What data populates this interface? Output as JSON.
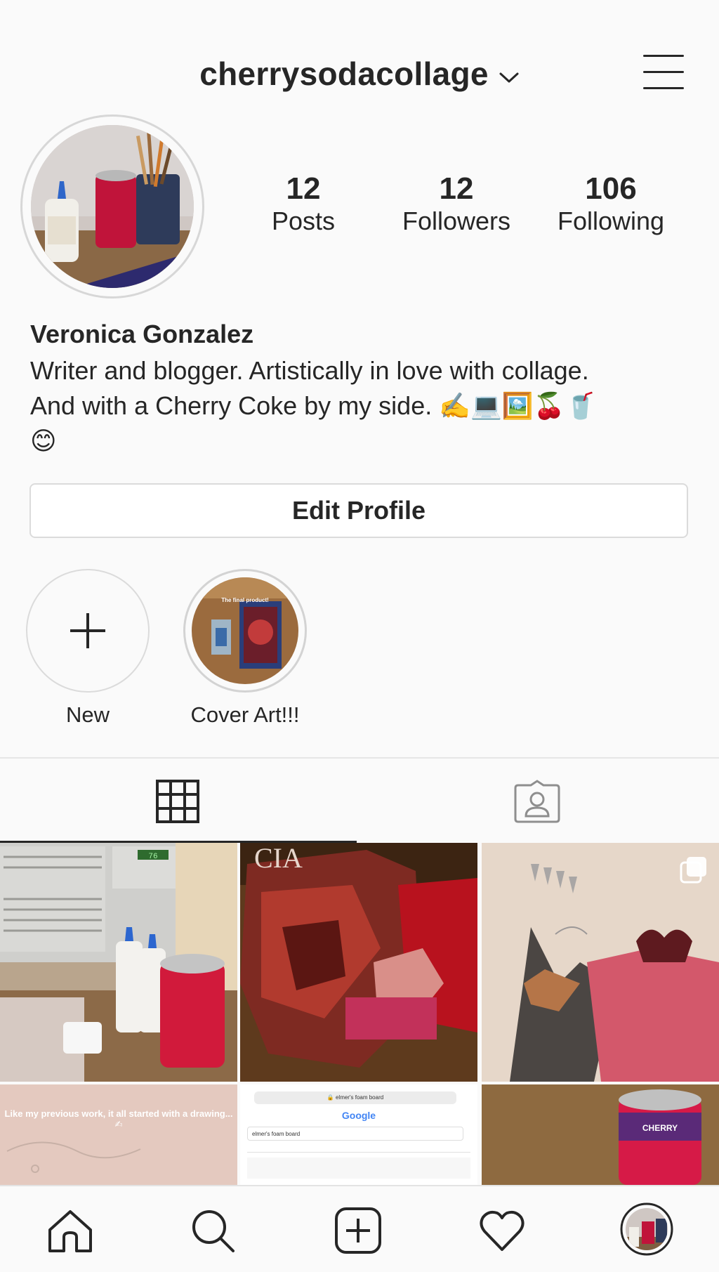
{
  "header": {
    "username": "cherrysodacollage",
    "icons": {
      "dropdown": "chevron-down-icon",
      "menu": "hamburger-menu-icon"
    }
  },
  "profile": {
    "stats": [
      {
        "value": "12",
        "label": "Posts"
      },
      {
        "value": "12",
        "label": "Followers"
      },
      {
        "value": "106",
        "label": "Following"
      }
    ],
    "name": "Veronica Gonzalez",
    "bio_line1": "Writer and blogger. Artistically in love with collage.",
    "bio_line2": "And with a Cherry Coke by my side.",
    "bio_emojis": "✍️💻🖼️🍒🥤",
    "bio_emoji2": "😊",
    "edit_button": "Edit Profile"
  },
  "highlights": [
    {
      "label": "New",
      "icon": "plus-icon"
    },
    {
      "label": "Cover Art!!!",
      "caption": "The final product!"
    }
  ],
  "tabs": [
    {
      "name": "grid",
      "icon": "grid-icon",
      "active": true
    },
    {
      "name": "tagged",
      "icon": "tagged-person-icon",
      "active": false
    }
  ],
  "posts": {
    "row2_caption": "Like my previous work, it all started with a drawing... ✍",
    "search_query": "elmer's foam board",
    "search_logo": "Google",
    "can_label": "CHERRY",
    "ac_display": "76"
  },
  "bottom_nav": [
    {
      "name": "home",
      "icon": "home-icon"
    },
    {
      "name": "search",
      "icon": "search-icon"
    },
    {
      "name": "new-post",
      "icon": "add-post-icon"
    },
    {
      "name": "activity",
      "icon": "heart-icon"
    },
    {
      "name": "profile",
      "icon": "avatar"
    }
  ],
  "colors": {
    "text": "#262626",
    "border": "#dbdbdb",
    "background": "#fafafa",
    "accent_red": "#c8102e"
  }
}
